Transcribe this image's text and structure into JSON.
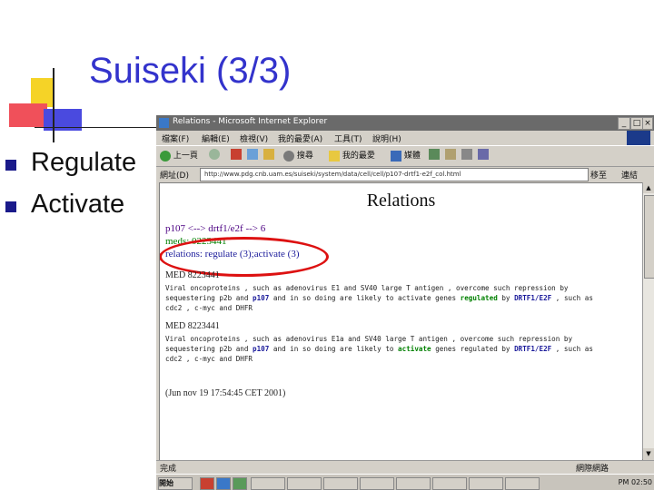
{
  "slide": {
    "title": "Suiseki (3/3)",
    "bullets": [
      "Regulate",
      "Activate"
    ]
  },
  "browser": {
    "window_title": "Relations - Microsoft Internet Explorer",
    "menu": [
      "檔案(F)",
      "編輯(E)",
      "檢視(V)",
      "我的最愛(A)",
      "工具(T)",
      "說明(H)"
    ],
    "toolbar": {
      "back": "上一頁",
      "search": "搜尋",
      "favorites": "我的最愛",
      "history": "媒體"
    },
    "address_label": "網址(D)",
    "address_value": "http://www.pdg.cnb.uam.es/suiseki/system/data/cell/cell/p107-drtf1-e2f_col.html",
    "go_label": "移至",
    "links_label": "連結",
    "page": {
      "heading": "Relations",
      "relation_line": "p107 <--> drtf1/e2f --> 6",
      "meds_line": "meds: 0223441",
      "relations_line": "relations: regulate (3);activate (3)",
      "med1_label": "MED 8223441",
      "med1_text": [
        "Viral oncoproteins , such as adenovirus E1 and SV40 large T antigen , overcome such repression by",
        "sequestering p2b and ",
        "p107",
        " and in so doing are likely to activate genes ",
        "regulated",
        " by ",
        "DRTF1/E2F",
        " , such as",
        "cdc2 , c-myc and DHFR"
      ],
      "med2_label": "MED 8223441",
      "med2_text": [
        "Viral oncoproteins , such as adenovirus E1a and SV40 large T antigen , overcome such repression by",
        "sequestering p2b and ",
        "p107",
        " and in so doing are likely to ",
        "activate",
        " genes regulated by ",
        "DRTF1/E2F",
        " , such as",
        "cdc2 , c-myc and DHFR"
      ],
      "timestamp": "(Jun nov 19 17:54:45 CET 2001)"
    },
    "status": {
      "left": "完成",
      "right": "網際網路"
    },
    "taskbar": {
      "start": "開始",
      "clock": "PM 02:50"
    }
  },
  "colors": {
    "title": "#3333cc",
    "relation_purple": "#4b0082",
    "meds_green": "#008000",
    "relations_blue": "#1a1a9a",
    "oval_red": "#dd1111"
  }
}
